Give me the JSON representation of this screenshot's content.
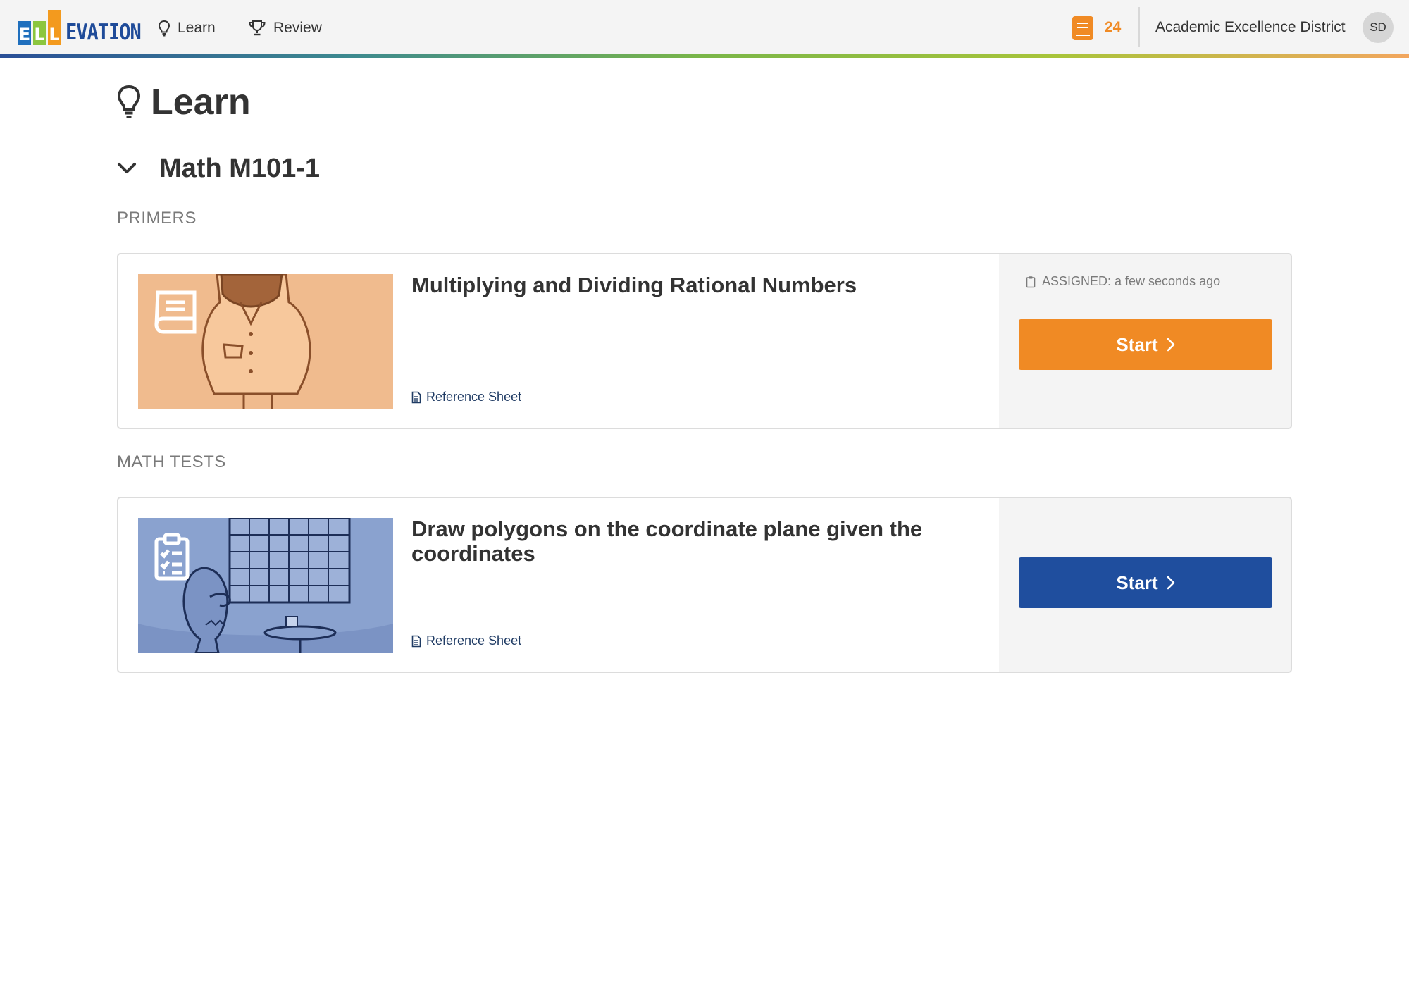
{
  "nav": {
    "logo_letters": [
      "E",
      "L",
      "L"
    ],
    "logo_word": "EVATION",
    "learn_label": "Learn",
    "review_label": "Review",
    "points": "24",
    "district": "Academic Excellence District",
    "avatar_initials": "SD"
  },
  "page": {
    "title": "Learn",
    "course": "Math M101-1"
  },
  "sections": [
    {
      "label": "PRIMERS",
      "card": {
        "title": "Multiplying and Dividing Rational Numbers",
        "ref_label": "Reference Sheet",
        "assigned": "ASSIGNED: a few seconds ago",
        "button_label": "Start",
        "button_color": "#f08a24",
        "thumb_bg": "#f0bb8e",
        "thumb_icon": "book-icon"
      }
    },
    {
      "label": "MATH TESTS",
      "card": {
        "title": "Draw polygons on the coordinate plane given the coordinates",
        "ref_label": "Reference Sheet",
        "button_label": "Start",
        "button_color": "#1f4e9e",
        "thumb_bg": "#8aa2cf",
        "thumb_icon": "clipboard-checklist-icon"
      }
    }
  ],
  "colors": {
    "accent_orange": "#f08a24",
    "accent_blue": "#1f4e9e",
    "topbar_bg": "#f4f4f4"
  }
}
